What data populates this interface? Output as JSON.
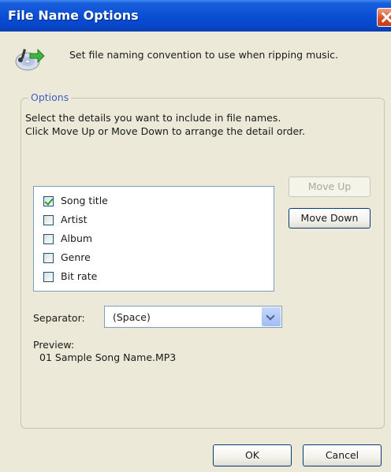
{
  "window": {
    "title": "File Name Options"
  },
  "header": {
    "icon": "cd-music-arrow-icon",
    "description": "Set file naming convention to use when ripping music."
  },
  "options": {
    "group_label": "Options",
    "instruction_1": "Select the details you want to include in file names.",
    "instruction_2": "Click Move Up or Move Down to arrange the detail order.",
    "details": [
      {
        "label": "Song title",
        "checked": true
      },
      {
        "label": "Artist",
        "checked": false
      },
      {
        "label": "Album",
        "checked": false
      },
      {
        "label": "Genre",
        "checked": false
      },
      {
        "label": "Bit rate",
        "checked": false
      }
    ],
    "move_up_label": "Move Up",
    "move_down_label": "Move Down",
    "separator_label": "Separator:",
    "separator_value": "(Space)",
    "preview_label": "Preview:",
    "preview_value": "01 Sample Song Name.MP3"
  },
  "buttons": {
    "ok": "OK",
    "cancel": "Cancel"
  },
  "colors": {
    "title_bar": "#0a4fd6",
    "group_label": "#3c5fc8",
    "check_mark": "#21a121"
  }
}
